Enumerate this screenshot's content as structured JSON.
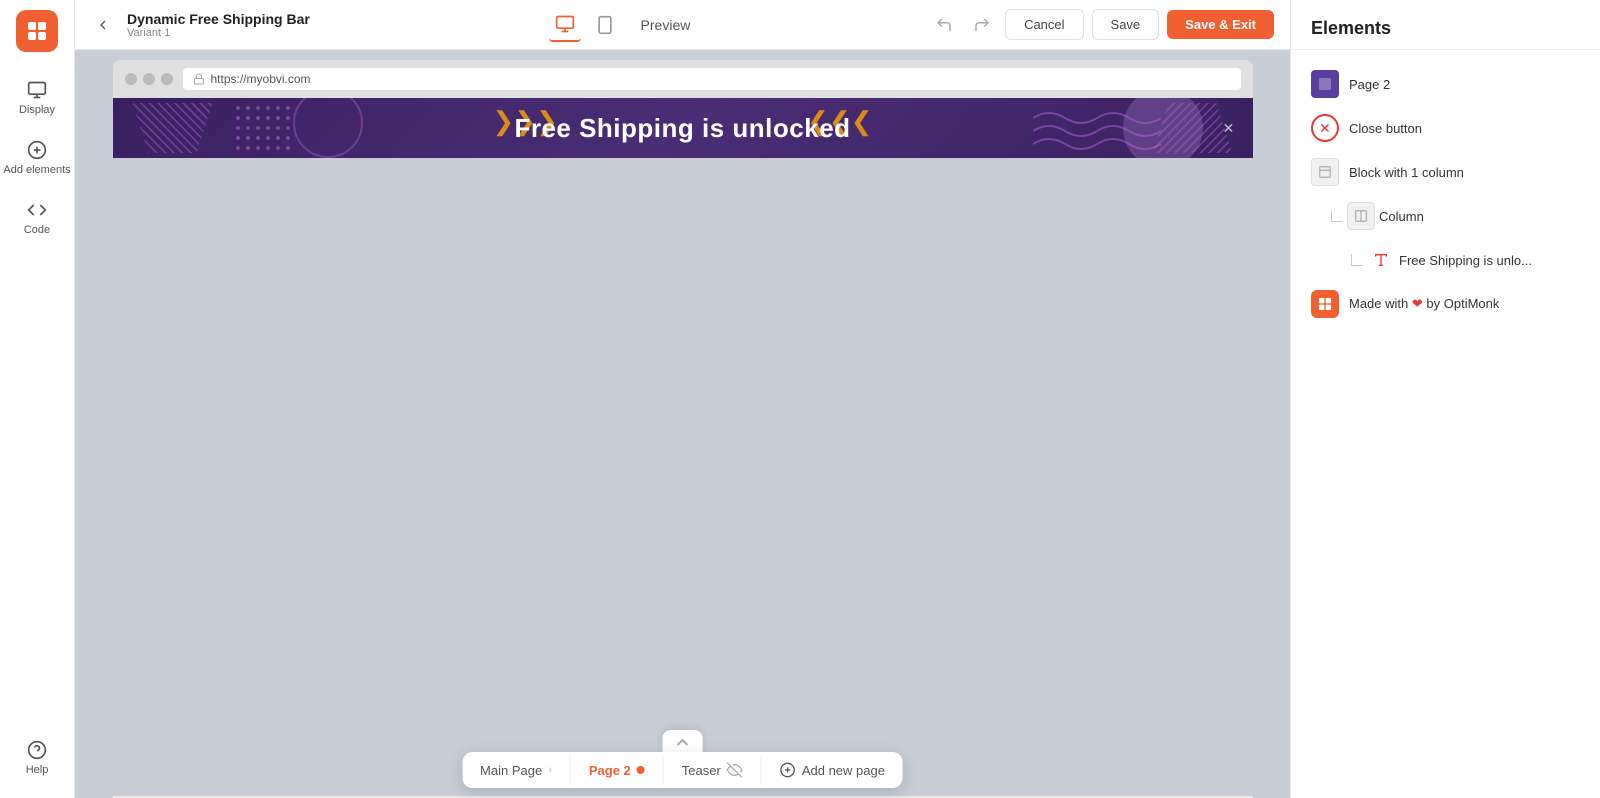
{
  "app": {
    "title": "Dynamic Free Shipping Bar",
    "subtitle": "Variant 1"
  },
  "topbar": {
    "back_label": "←",
    "preview_label": "Preview",
    "cancel_label": "Cancel",
    "save_label": "Save",
    "save_exit_label": "Save & Exit",
    "url": "https://myobvi.com"
  },
  "sidebar": {
    "display_label": "Display",
    "add_elements_label": "Add elements",
    "code_label": "Code",
    "help_label": "Help"
  },
  "banner": {
    "text": "Free Shipping is unlocked"
  },
  "right_panel": {
    "title": "Elements",
    "items": [
      {
        "id": "page2",
        "label": "Page 2",
        "type": "page",
        "indent": 0
      },
      {
        "id": "close-button",
        "label": "Close button",
        "type": "close",
        "indent": 0
      },
      {
        "id": "block-1col",
        "label": "Block with 1 column",
        "type": "block",
        "indent": 0
      },
      {
        "id": "column",
        "label": "Column",
        "type": "column",
        "indent": 1
      },
      {
        "id": "text-node",
        "label": "Free Shipping is unlo...",
        "type": "text",
        "indent": 2
      },
      {
        "id": "brand",
        "label": "Made with ❤ by OptiMonk",
        "type": "brand",
        "indent": 0
      }
    ]
  },
  "tabs": {
    "main_page_label": "Main Page",
    "page2_label": "Page 2",
    "teaser_label": "Teaser",
    "add_new_page_label": "Add new page"
  }
}
